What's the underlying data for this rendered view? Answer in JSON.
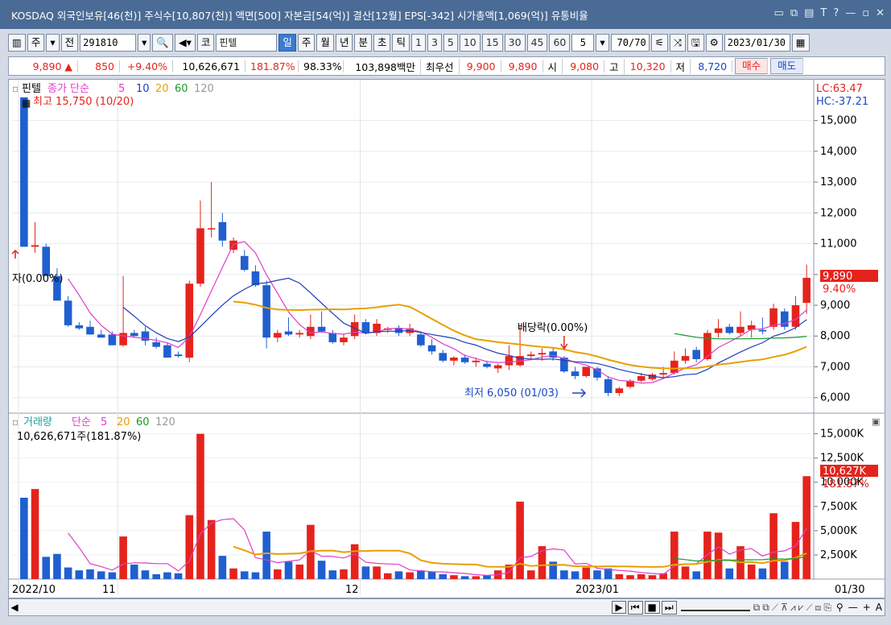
{
  "window": {
    "title": "KOSDAQ 외국인보유[46(천)] 주식수[10,807(천)] 액면[500] 자본금[54(억)] 결산[12월] EPS[-342] 시가총액[1,069(억)] 유통비율",
    "controls": [
      "▭",
      "⧉",
      "▤",
      "T",
      "?",
      "—",
      "▫",
      "✕"
    ]
  },
  "toolbar": {
    "left_buttons": [
      "주",
      "전"
    ],
    "code": "291810",
    "stock_prefix": "코",
    "stock_name": "핀텔",
    "period_tabs": [
      "일",
      "주",
      "월",
      "년",
      "분",
      "초",
      "틱"
    ],
    "selected_period": "일",
    "intervals": [
      "1",
      "3",
      "5",
      "10",
      "15",
      "30",
      "45",
      "60"
    ],
    "interval_value": "5",
    "count": "70/70",
    "date": "2023/01/30"
  },
  "quote": {
    "price": "9,890 ▲",
    "change": "850",
    "change_pct": "+9.40%",
    "volume": "10,626,671",
    "vol_ratio": "181.87%",
    "strength": "98.33%",
    "amount": "103,898백만",
    "best_label": "최우선",
    "ask": "9,900",
    "bid": "9,890",
    "open_label": "시",
    "open": "9,080",
    "high_label": "고",
    "high": "10,320",
    "low_label": "저",
    "low": "8,720",
    "buy_label": "매수",
    "sell_label": "매도"
  },
  "price_panel": {
    "name": "핀텔",
    "ma_label": "종가 단순",
    "ma_periods": [
      "5",
      "10",
      "20",
      "60",
      "120"
    ],
    "ma_colors": [
      "#e03cc8",
      "#1f3fb8",
      "#e8a000",
      "#1a9a2a",
      "#999999"
    ],
    "high_annotation": "최고 15,750 (10/20)",
    "low_annotation": "최저 6,050 (01/03)",
    "div_annotation": "배당락(0.00%)",
    "left_annotation": "자(0.00%)",
    "lc": "LC:63.47",
    "hc": "HC:-37.21",
    "y_ticks": [
      "15,000",
      "14,000",
      "13,000",
      "12,000",
      "11,000",
      "10,000",
      "9,000",
      "8,000",
      "7,000",
      "6,000"
    ],
    "current_price_tag": "9,890",
    "current_pct_tag": "9.40%"
  },
  "volume_panel": {
    "label": "거래량",
    "ma_label": "단순",
    "ma_periods": [
      "5",
      "20",
      "60",
      "120"
    ],
    "current": "10,626,671주(181.87%)",
    "y_ticks": [
      "15,000K",
      "12,500K",
      "10,000K",
      "7,500K",
      "5,000K",
      "2,500K"
    ],
    "current_tag": "10,627K",
    "current_pct_tag": "181.87%"
  },
  "x_axis": {
    "labels": [
      "2022/10",
      "11",
      "12",
      "2023/01"
    ],
    "right_label": "01/30"
  },
  "colors": {
    "up": "#e5231c",
    "down": "#1f5fd0",
    "title_bar": "#4a6b95"
  },
  "chart_data": {
    "type": "candlestick",
    "title": "",
    "y_range": [
      5600,
      15800
    ],
    "volume_range_k": [
      0,
      15800
    ],
    "candles": [
      {
        "date": "10/19",
        "o": 15750,
        "h": 15750,
        "l": 10900,
        "c": 10900,
        "v": 8400
      },
      {
        "date": "10/20",
        "o": 10900,
        "h": 11700,
        "l": 10700,
        "c": 10950,
        "v": 9300
      },
      {
        "date": "10/21",
        "o": 10900,
        "h": 11000,
        "l": 10000,
        "c": 9950,
        "v": 2300
      },
      {
        "date": "10/24",
        "o": 9950,
        "h": 10200,
        "l": 9700,
        "c": 9150,
        "v": 2600
      },
      {
        "date": "10/25",
        "o": 9150,
        "h": 9300,
        "l": 8300,
        "c": 8350,
        "v": 1200
      },
      {
        "date": "10/26",
        "o": 8350,
        "h": 8450,
        "l": 8200,
        "c": 8250,
        "v": 900
      },
      {
        "date": "10/27",
        "o": 8300,
        "h": 8500,
        "l": 8050,
        "c": 8050,
        "v": 1000
      },
      {
        "date": "10/28",
        "o": 8050,
        "h": 8200,
        "l": 7950,
        "c": 7950,
        "v": 800
      },
      {
        "date": "10/31",
        "o": 8050,
        "h": 8150,
        "l": 7700,
        "c": 7700,
        "v": 700
      },
      {
        "date": "11/01",
        "o": 7700,
        "h": 9950,
        "l": 7650,
        "c": 8100,
        "v": 4400
      },
      {
        "date": "11/02",
        "o": 8100,
        "h": 8200,
        "l": 7950,
        "c": 8000,
        "v": 1500
      },
      {
        "date": "11/03",
        "o": 8150,
        "h": 8300,
        "l": 7700,
        "c": 7850,
        "v": 900
      },
      {
        "date": "11/04",
        "o": 7800,
        "h": 7950,
        "l": 7600,
        "c": 7650,
        "v": 500
      },
      {
        "date": "11/07",
        "o": 7700,
        "h": 7800,
        "l": 7300,
        "c": 7300,
        "v": 700
      },
      {
        "date": "11/08",
        "o": 7400,
        "h": 7500,
        "l": 7300,
        "c": 7350,
        "v": 600
      },
      {
        "date": "11/09",
        "o": 7300,
        "h": 9800,
        "l": 7150,
        "c": 9700,
        "v": 6600
      },
      {
        "date": "11/10",
        "o": 9700,
        "h": 12400,
        "l": 9600,
        "c": 11500,
        "v": 15000
      },
      {
        "date": "11/11",
        "o": 11500,
        "h": 13000,
        "l": 11200,
        "c": 11500,
        "v": 6100
      },
      {
        "date": "11/14",
        "o": 11700,
        "h": 12000,
        "l": 10900,
        "c": 11100,
        "v": 2400
      },
      {
        "date": "11/15",
        "o": 10800,
        "h": 11200,
        "l": 10700,
        "c": 11100,
        "v": 1100
      },
      {
        "date": "11/16",
        "o": 10600,
        "h": 10800,
        "l": 10100,
        "c": 10150,
        "v": 800
      },
      {
        "date": "11/17",
        "o": 10100,
        "h": 10300,
        "l": 9600,
        "c": 9650,
        "v": 700
      },
      {
        "date": "11/18",
        "o": 9650,
        "h": 9800,
        "l": 7600,
        "c": 7950,
        "v": 4900
      },
      {
        "date": "11/21",
        "o": 7950,
        "h": 8200,
        "l": 7800,
        "c": 8100,
        "v": 1000
      },
      {
        "date": "11/22",
        "o": 8150,
        "h": 8600,
        "l": 8000,
        "c": 8050,
        "v": 1800
      },
      {
        "date": "11/23",
        "o": 8050,
        "h": 8200,
        "l": 7950,
        "c": 8100,
        "v": 1500
      },
      {
        "date": "11/24",
        "o": 8000,
        "h": 8700,
        "l": 7900,
        "c": 8300,
        "v": 5600
      },
      {
        "date": "11/25",
        "o": 8300,
        "h": 8800,
        "l": 8100,
        "c": 8150,
        "v": 1900
      },
      {
        "date": "11/28",
        "o": 8100,
        "h": 8200,
        "l": 7750,
        "c": 7800,
        "v": 900
      },
      {
        "date": "11/29",
        "o": 7800,
        "h": 8050,
        "l": 7700,
        "c": 7950,
        "v": 1000
      },
      {
        "date": "11/30",
        "o": 8000,
        "h": 8700,
        "l": 7900,
        "c": 8450,
        "v": 3600
      },
      {
        "date": "12/01",
        "o": 8450,
        "h": 8550,
        "l": 8050,
        "c": 8100,
        "v": 1300
      },
      {
        "date": "12/02",
        "o": 8100,
        "h": 8550,
        "l": 8000,
        "c": 8400,
        "v": 1300
      },
      {
        "date": "12/05",
        "o": 8200,
        "h": 8300,
        "l": 8100,
        "c": 8250,
        "v": 600
      },
      {
        "date": "12/06",
        "o": 8250,
        "h": 8350,
        "l": 8000,
        "c": 8100,
        "v": 800
      },
      {
        "date": "12/07",
        "o": 8100,
        "h": 8400,
        "l": 8000,
        "c": 8250,
        "v": 700
      },
      {
        "date": "12/08",
        "o": 8050,
        "h": 8100,
        "l": 7650,
        "c": 7700,
        "v": 900
      },
      {
        "date": "12/09",
        "o": 7700,
        "h": 7900,
        "l": 7400,
        "c": 7500,
        "v": 800
      },
      {
        "date": "12/12",
        "o": 7450,
        "h": 7550,
        "l": 7150,
        "c": 7200,
        "v": 500
      },
      {
        "date": "12/13",
        "o": 7200,
        "h": 7350,
        "l": 7050,
        "c": 7300,
        "v": 400
      },
      {
        "date": "12/14",
        "o": 7300,
        "h": 7400,
        "l": 7100,
        "c": 7150,
        "v": 300
      },
      {
        "date": "12/15",
        "o": 7150,
        "h": 7300,
        "l": 7000,
        "c": 7200,
        "v": 300
      },
      {
        "date": "12/16",
        "o": 7100,
        "h": 7200,
        "l": 6950,
        "c": 7000,
        "v": 400
      },
      {
        "date": "12/19",
        "o": 6950,
        "h": 7100,
        "l": 6800,
        "c": 7050,
        "v": 900
      },
      {
        "date": "12/20",
        "o": 7050,
        "h": 7700,
        "l": 6900,
        "c": 7350,
        "v": 1500
      },
      {
        "date": "12/21",
        "o": 7050,
        "h": 8300,
        "l": 7000,
        "c": 7350,
        "v": 8000
      },
      {
        "date": "12/22",
        "o": 7350,
        "h": 7500,
        "l": 7250,
        "c": 7400,
        "v": 900
      },
      {
        "date": "12/23",
        "o": 7400,
        "h": 7600,
        "l": 7200,
        "c": 7450,
        "v": 3400
      },
      {
        "date": "12/26",
        "o": 7500,
        "h": 7600,
        "l": 7200,
        "c": 7300,
        "v": 1800
      },
      {
        "date": "12/27",
        "o": 7300,
        "h": 7350,
        "l": 6800,
        "c": 6850,
        "v": 900
      },
      {
        "date": "12/28",
        "o": 6850,
        "h": 7000,
        "l": 6600,
        "c": 6700,
        "v": 800
      },
      {
        "date": "12/29",
        "o": 6700,
        "h": 7000,
        "l": 6650,
        "c": 7000,
        "v": 1200
      },
      {
        "date": "01/02",
        "o": 6950,
        "h": 7000,
        "l": 6550,
        "c": 6650,
        "v": 900
      },
      {
        "date": "01/03",
        "o": 6600,
        "h": 6700,
        "l": 6050,
        "c": 6150,
        "v": 1100
      },
      {
        "date": "01/04",
        "o": 6150,
        "h": 6350,
        "l": 6050,
        "c": 6300,
        "v": 500
      },
      {
        "date": "01/05",
        "o": 6350,
        "h": 6600,
        "l": 6300,
        "c": 6550,
        "v": 400
      },
      {
        "date": "01/06",
        "o": 6550,
        "h": 6800,
        "l": 6500,
        "c": 6700,
        "v": 500
      },
      {
        "date": "01/09",
        "o": 6600,
        "h": 6800,
        "l": 6550,
        "c": 6750,
        "v": 400
      },
      {
        "date": "01/10",
        "o": 6750,
        "h": 7000,
        "l": 6650,
        "c": 6800,
        "v": 600
      },
      {
        "date": "01/11",
        "o": 6800,
        "h": 7500,
        "l": 6750,
        "c": 7200,
        "v": 4900
      },
      {
        "date": "01/12",
        "o": 7200,
        "h": 7600,
        "l": 7100,
        "c": 7350,
        "v": 1300
      },
      {
        "date": "01/13",
        "o": 7550,
        "h": 7650,
        "l": 7150,
        "c": 7250,
        "v": 800
      },
      {
        "date": "01/16",
        "o": 7250,
        "h": 8200,
        "l": 7200,
        "c": 8100,
        "v": 4900
      },
      {
        "date": "01/17",
        "o": 8100,
        "h": 8550,
        "l": 7950,
        "c": 8250,
        "v": 4800
      },
      {
        "date": "01/18",
        "o": 8300,
        "h": 8400,
        "l": 8050,
        "c": 8100,
        "v": 1100
      },
      {
        "date": "01/19",
        "o": 8100,
        "h": 8800,
        "l": 8000,
        "c": 8300,
        "v": 3400
      },
      {
        "date": "01/20",
        "o": 8200,
        "h": 8500,
        "l": 7950,
        "c": 8350,
        "v": 1500
      },
      {
        "date": "01/25",
        "o": 8200,
        "h": 8600,
        "l": 8050,
        "c": 8150,
        "v": 1100
      },
      {
        "date": "01/26",
        "o": 8300,
        "h": 9050,
        "l": 8200,
        "c": 8900,
        "v": 6800
      },
      {
        "date": "01/27",
        "o": 8800,
        "h": 8900,
        "l": 8200,
        "c": 8300,
        "v": 1800
      },
      {
        "date": "01/28",
        "o": 8300,
        "h": 9300,
        "l": 8200,
        "c": 9000,
        "v": 5900
      },
      {
        "date": "01/30",
        "o": 9080,
        "h": 10320,
        "l": 8720,
        "c": 9890,
        "v": 10627
      }
    ]
  }
}
